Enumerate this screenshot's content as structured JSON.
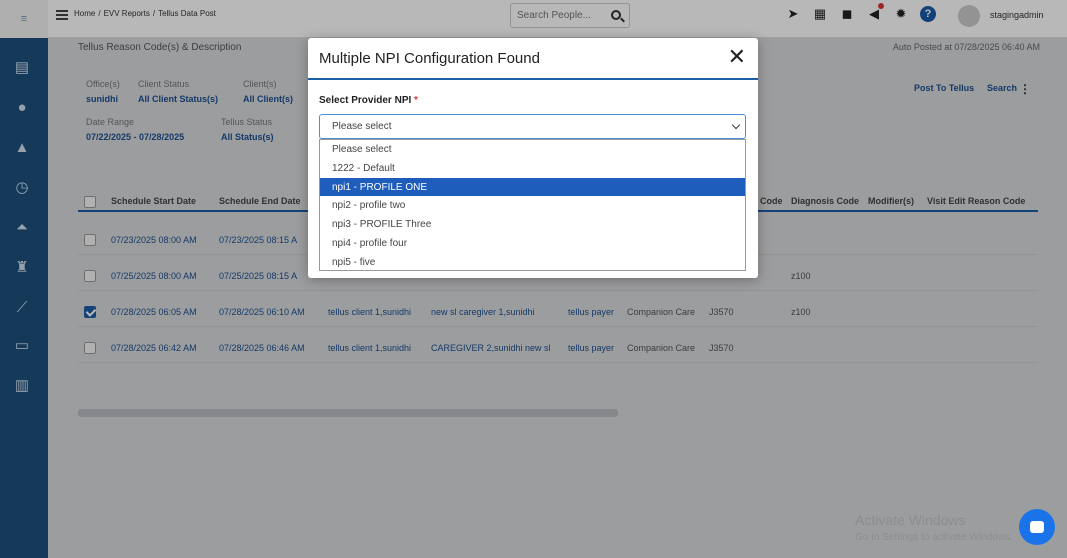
{
  "header": {
    "breadcrumb": [
      "Home",
      "/",
      "EVV Reports",
      "/",
      "Tellus Data Post"
    ],
    "search_placeholder": "Search People...",
    "username": "stagingadmin"
  },
  "sidebar": {
    "icons": [
      "dashboard-icon",
      "user-icon",
      "person-icon",
      "clock-icon",
      "lab-icon",
      "tree-icon",
      "chart-icon",
      "card-icon",
      "report-icon"
    ]
  },
  "page": {
    "section_title": "Tellus Reason Code(s) & Description",
    "auto_posted": "Auto Posted at 07/28/2025 06:40 AM",
    "filters": {
      "office_label": "Office(s)",
      "office_value": "sunidhi",
      "client_status_label": "Client Status",
      "client_status_value": "All Client Status(s)",
      "clients_label": "Client(s)",
      "clients_value": "All Client(s)",
      "date_range_label": "Date Range",
      "date_range_value": "07/22/2025 - 07/28/2025",
      "tellus_status_label": "Tellus Status",
      "tellus_status_value": "All Status(s)"
    },
    "actions": {
      "post_to_tellus": "Post To Tellus",
      "search": "Search"
    },
    "table": {
      "headers": [
        "Schedule Start Date",
        "Schedule End Date",
        "Code",
        "Diagnosis Code",
        "Modifier(s)",
        "Visit Edit Reason Code"
      ],
      "rows": [
        {
          "checked": false,
          "start": "07/23/2025 08:00 AM",
          "end": "07/23/2025 08:15 A",
          "client": "",
          "caregiver": "",
          "payer": "",
          "service": "",
          "code": "",
          "diag": ""
        },
        {
          "checked": false,
          "start": "07/25/2025 08:00 AM",
          "end": "07/25/2025 08:15 A",
          "client": "",
          "caregiver": "",
          "payer": "",
          "service": "",
          "code": "",
          "diag": "z100"
        },
        {
          "checked": true,
          "start": "07/28/2025 06:05 AM",
          "end": "07/28/2025 06:10 AM",
          "client": "tellus client 1,sunidhi",
          "caregiver": "new sl caregiver 1,sunidhi",
          "payer": "tellus payer",
          "service": "Companion Care",
          "code": "J3570",
          "diag": "z100"
        },
        {
          "checked": false,
          "start": "07/28/2025 06:42 AM",
          "end": "07/28/2025 06:46 AM",
          "client": "tellus client 1,sunidhi",
          "caregiver": "CAREGIVER 2,sunidhi new sl",
          "payer": "tellus payer",
          "service": "Companion Care",
          "code": "J3570",
          "diag": ""
        }
      ]
    }
  },
  "modal": {
    "title": "Multiple NPI Configuration Found",
    "field_label": "Select Provider NPI",
    "required_mark": "*",
    "select_value": "Please select",
    "options": [
      "Please select",
      "1222 - Default",
      "npi1 - PROFILE ONE",
      "npi2 - profile two",
      "npi3 - PROFILE Three",
      "npi4 - profile four",
      "npi5 - five"
    ],
    "highlighted_option": "npi1 - PROFILE ONE"
  },
  "watermark": {
    "title": "Activate Windows",
    "subtitle": "Go to Settings to activate Windows."
  }
}
